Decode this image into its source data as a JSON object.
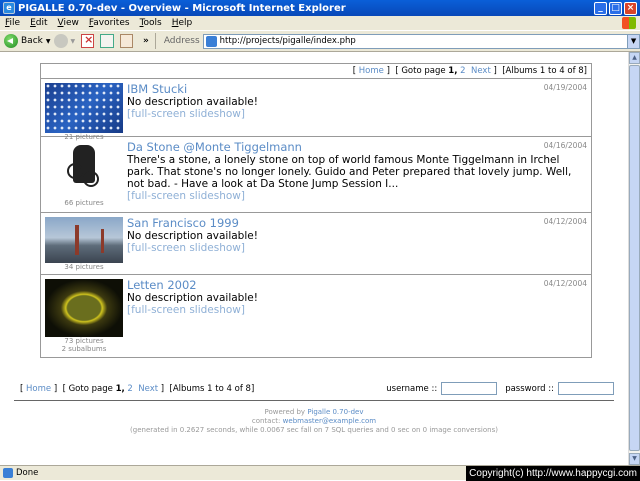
{
  "window": {
    "title": "PIGALLE 0.70-dev - Overview - Microsoft Internet Explorer",
    "min": "_",
    "max": "□",
    "close": "×"
  },
  "menu": {
    "items": [
      "File",
      "Edit",
      "View",
      "Favorites",
      "Tools",
      "Help"
    ]
  },
  "toolbar": {
    "back_label": "Back",
    "address_label": "Address",
    "url": "http://projects/pigalle/index.php",
    "chevron": "»"
  },
  "nav": {
    "home": "Home",
    "goto_prefix": "[ Goto page",
    "page_current": "1,",
    "page_other": "2",
    "next": "Next",
    "suffix": "]",
    "range": "[Albums 1 to 4 of 8]",
    "bracket_open": "[",
    "bracket_close": "]"
  },
  "albums": [
    {
      "name": "IBM Stucki",
      "description": "No description available!",
      "slideshow": "[full-screen slideshow]",
      "date": "04/19/2004",
      "counts": [
        "21 pictures"
      ]
    },
    {
      "name": "Da Stone @Monte Tiggelmann",
      "description": "There's a stone, a lonely stone on top of world famous Monte Tiggelmann in Irchel park. That stone's no longer lonely. Guido and Peter prepared that lovely jump. Well, not bad. - Have a look at Da Stone Jump Session I...",
      "slideshow": "[full-screen slideshow]",
      "date": "04/16/2004",
      "counts": [
        "66 pictures"
      ]
    },
    {
      "name": "San Francisco 1999",
      "description": "No description available!",
      "slideshow": "[full-screen slideshow]",
      "date": "04/12/2004",
      "counts": [
        "34 pictures"
      ]
    },
    {
      "name": "Letten 2002",
      "description": "No description available!",
      "slideshow": "[full-screen slideshow]",
      "date": "04/12/2004",
      "counts": [
        "73 pictures",
        "2 subalbums"
      ]
    }
  ],
  "login": {
    "username_label": "username ::",
    "password_label": "password ::",
    "username_value": "",
    "password_value": ""
  },
  "footer": {
    "powered_prefix": "Powered by",
    "powered_link": "Pigalle 0.70-dev",
    "contact_prefix": "contact:",
    "contact_link": "webmaster@example.com",
    "stats": "(generated in 0.2627 seconds, while 0.0067 sec fall on 7 SQL queries and 0 sec on 0 image conversions)"
  },
  "status": {
    "text": "Done",
    "copyright": "Copyright(c) http://www.happycgi.com"
  }
}
